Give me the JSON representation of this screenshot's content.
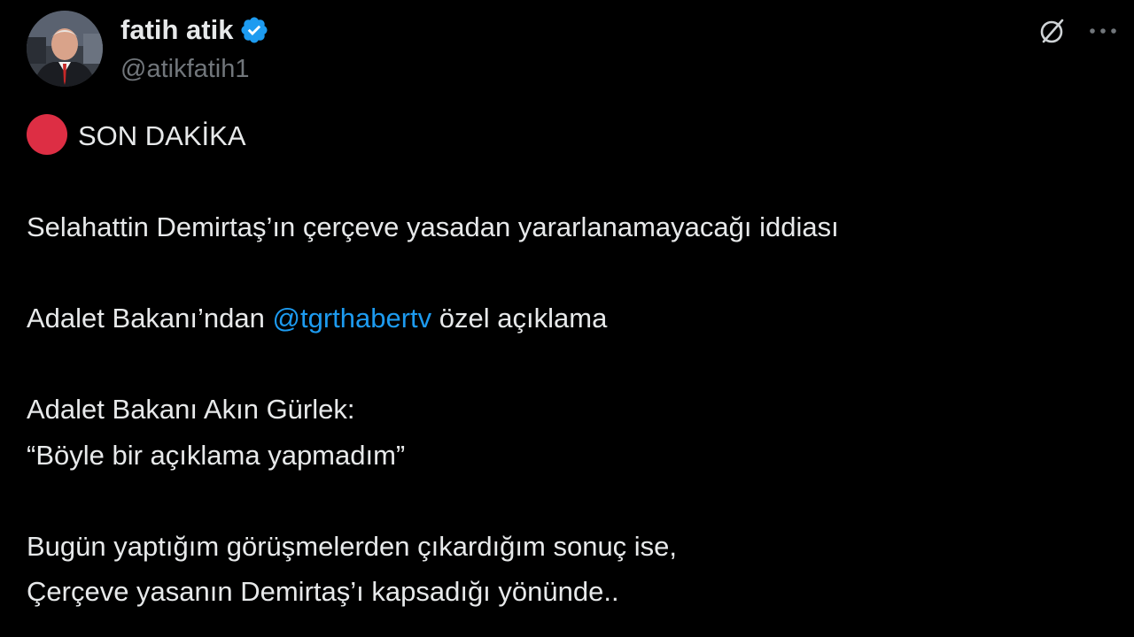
{
  "tweet": {
    "author": {
      "display_name": "fatih atik",
      "handle": "@atikfatih1",
      "verified": true,
      "avatar_icon": "avatar-photo"
    },
    "actions": {
      "grok_icon": "grok-slash-circle-icon",
      "more_icon": "more-horizontal-icon"
    },
    "text": {
      "breaking_label": "SON DAKİKA",
      "line_1": "Selahattin Demirtaş’ın çerçeve yasadan yararlanamayacağı iddiası",
      "line_2_before": "Adalet Bakanı’ndan ",
      "line_2_mention": "@tgrthabertv",
      "line_2_after": " özel açıklama",
      "line_3": "Adalet Bakanı Akın Gürlek:",
      "line_4": "“Böyle bir açıklama yapmadım”",
      "line_5": "Bugün yaptığım görüşmelerden çıkardığım sonuç ise,",
      "line_6": "Çerçeve yasanın Demirtaş’ı kapsadığı yönünde.."
    }
  },
  "colors": {
    "background": "#000000",
    "text_primary": "#e7e9ea",
    "text_secondary": "#71767b",
    "link": "#1d9bf0",
    "verified_badge": "#1d9bf0",
    "breaking_dot": "#dd2e44"
  }
}
